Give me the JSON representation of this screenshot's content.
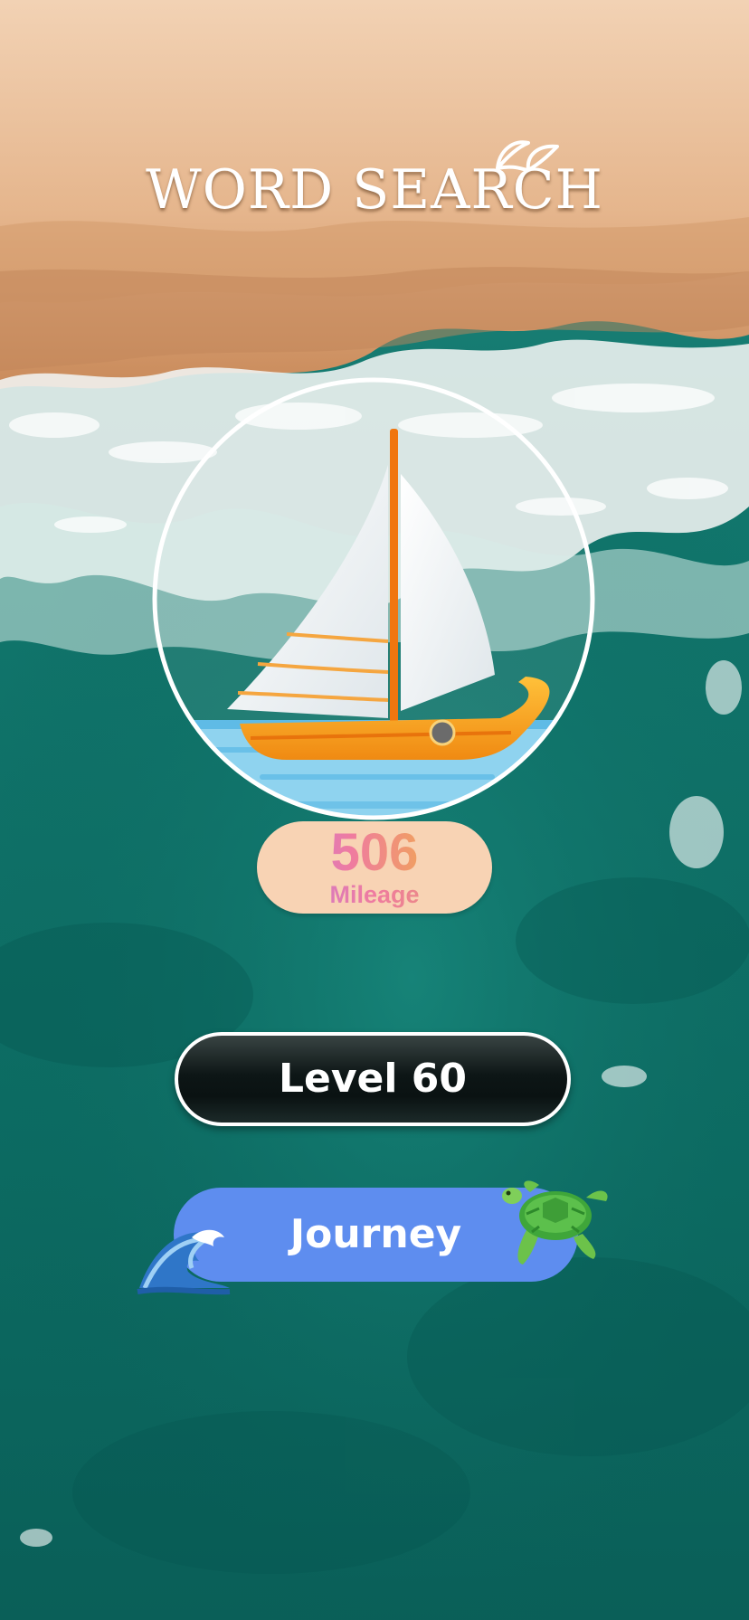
{
  "title": "WORD SEARCH",
  "mileage": {
    "value": "506",
    "label": "Mileage"
  },
  "level_button": {
    "label": "Level 60"
  },
  "journey_button": {
    "label": "Journey"
  },
  "icons": {
    "title_decoration": "sprout-icon",
    "emblem": "sailboat-icon",
    "journey_left": "ocean-wave-icon",
    "journey_right": "turtle-icon"
  },
  "colors": {
    "sand": "#e7b890",
    "ocean": "#0f6f66",
    "journey_button": "#5e8def",
    "mileage_pill": "#f8d3b4"
  }
}
